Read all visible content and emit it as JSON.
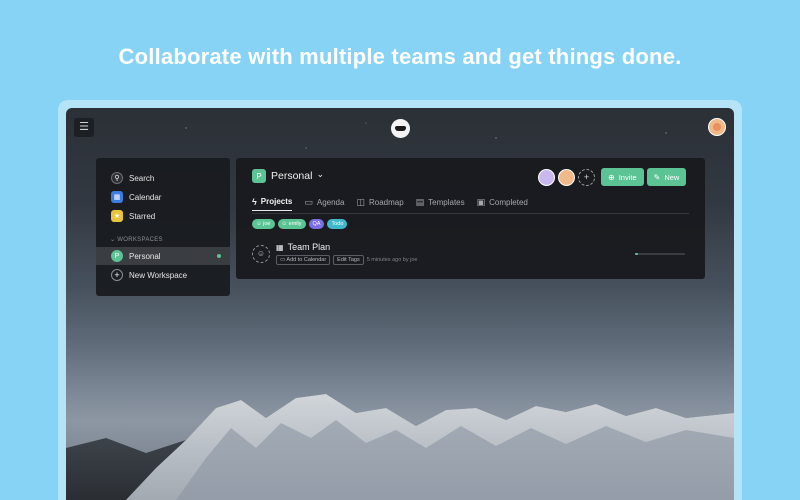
{
  "headline": "Collaborate with multiple teams and get things done.",
  "app": {
    "menu_icon": "☰",
    "logo_icon": "app-logo-icon",
    "user_avatar_icon": "user-avatar-icon"
  },
  "sidebar": {
    "items": [
      {
        "label": "Search",
        "icon": "search-icon",
        "glyph": "⚲",
        "color": "#2c2f34"
      },
      {
        "label": "Calendar",
        "icon": "calendar-icon",
        "glyph": "▦",
        "color": "#3b7de0"
      },
      {
        "label": "Starred",
        "icon": "star-icon",
        "glyph": "★",
        "color": "#e8c53a"
      }
    ],
    "workspaces_header": "WORKSPACES",
    "workspaces": [
      {
        "label": "Personal",
        "glyph": "P",
        "color": "#5bc394",
        "active": true
      }
    ],
    "new_workspace": {
      "label": "New Workspace",
      "glyph": "+"
    }
  },
  "panel": {
    "workspace_name": "Personal",
    "workspace_glyph": "P",
    "dropdown_glyph": "⌄",
    "tabs": [
      {
        "label": "Projects",
        "glyph": "ϟ",
        "active": true
      },
      {
        "label": "Agenda",
        "glyph": "▭",
        "active": false
      },
      {
        "label": "Roadmap",
        "glyph": "◫",
        "active": false
      },
      {
        "label": "Templates",
        "glyph": "▤",
        "active": false
      },
      {
        "label": "Completed",
        "glyph": "▣",
        "active": false
      }
    ],
    "tags": [
      {
        "label": "joe",
        "color": "#5bc394"
      },
      {
        "label": "emily",
        "color": "#5bc394"
      },
      {
        "label": "QA",
        "color": "#7c6ee6"
      },
      {
        "label": "Todo",
        "color": "#3fb8c9"
      }
    ],
    "project": {
      "title": "Team Plan",
      "add_to_calendar": "Add to Calendar",
      "edit_tags": "Edit Tags",
      "meta": "5 minutes ago by joe",
      "progress": 0.05
    },
    "members": [
      {
        "icon": "member-avatar-icon",
        "color": "#c9b8f0"
      },
      {
        "icon": "member-avatar-icon",
        "color": "#f1b98a"
      }
    ],
    "add_member_glyph": "+",
    "invite_label": "Invite",
    "new_label": "New"
  },
  "colors": {
    "accent": "#5bc394",
    "background": "#87d3f5"
  }
}
